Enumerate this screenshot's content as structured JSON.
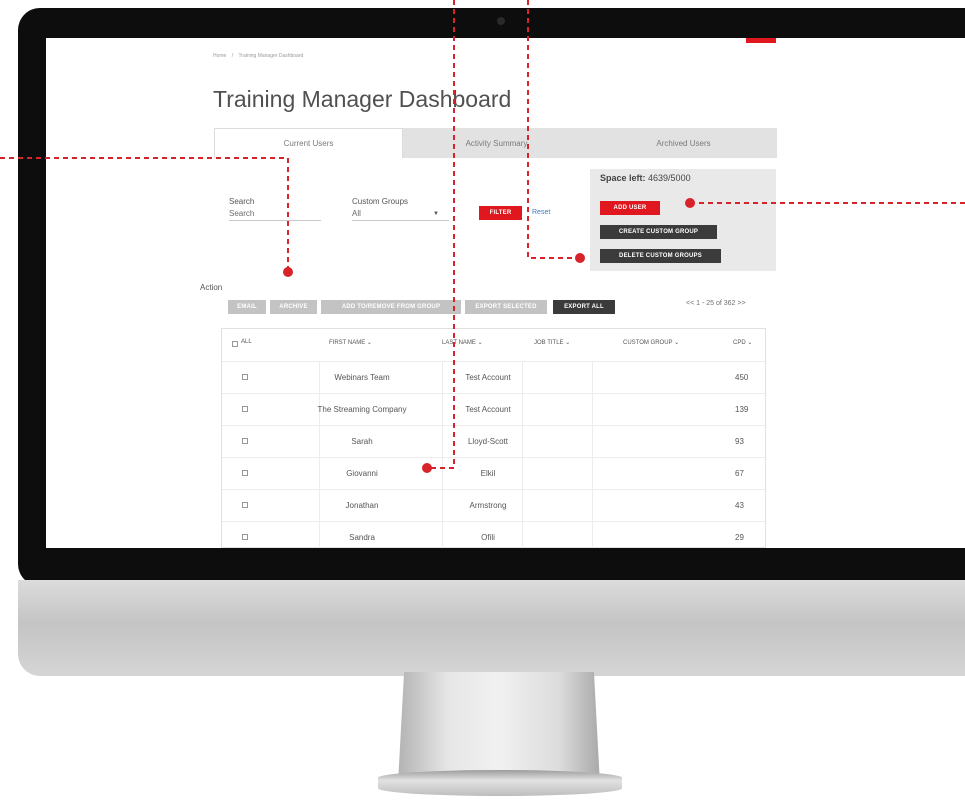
{
  "breadcrumb": {
    "home": "Home",
    "separator": "/",
    "current": "Training Manager Dashboard"
  },
  "page_title": "Training Manager Dashboard",
  "tabs": [
    {
      "label": "Current Users",
      "active": true
    },
    {
      "label": "Activity Summary",
      "active": false
    },
    {
      "label": "Archived Users",
      "active": false
    }
  ],
  "filters": {
    "search_label": "Search",
    "search_placeholder": "Search",
    "groups_label": "Custom Groups",
    "groups_value": "All",
    "filter_button": "FILTER",
    "reset_link": "Reset"
  },
  "space": {
    "label": "Space left:",
    "value": "4639/5000",
    "add_user": "ADD USER",
    "create_group": "CREATE CUSTOM GROUP",
    "delete_groups": "DELETE CUSTOM GROUPS"
  },
  "actions": {
    "label": "Action",
    "email": "EMAIL",
    "archive": "ARCHIVE",
    "add_remove": "ADD TO/REMOVE FROM GROUP",
    "export_selected": "EXPORT SELECTED",
    "export_all": "EXPORT ALL"
  },
  "pagination": "<< 1 - 25 of 362 >>",
  "table": {
    "headers": {
      "all": "ALL",
      "first_name": "FIRST NAME",
      "last_name": "LAST NAME",
      "job_title": "JOB TITLE",
      "custom_group": "CUSTOM GROUP",
      "cpd": "CPD"
    },
    "rows": [
      {
        "first": "Webinars Team",
        "last": "Test Account",
        "job": "",
        "group": "",
        "cpd": "450"
      },
      {
        "first": "The Streaming Company",
        "last": "Test Account",
        "job": "",
        "group": "",
        "cpd": "139"
      },
      {
        "first": "Sarah",
        "last": "Lloyd-Scott",
        "job": "",
        "group": "",
        "cpd": "93"
      },
      {
        "first": "Giovanni",
        "last": "Elkil",
        "job": "",
        "group": "",
        "cpd": "67"
      },
      {
        "first": "Jonathan",
        "last": "Armstrong",
        "job": "",
        "group": "",
        "cpd": "43"
      },
      {
        "first": "Sandra",
        "last": "Ofili",
        "job": "",
        "group": "",
        "cpd": "29"
      }
    ]
  },
  "colors": {
    "accent_red": "#e0171f",
    "dark_button": "#3b3b3b",
    "disabled_button": "#c3c3c3",
    "tab_inactive": "#e2e2e2",
    "link_blue": "#3c7bbf"
  }
}
